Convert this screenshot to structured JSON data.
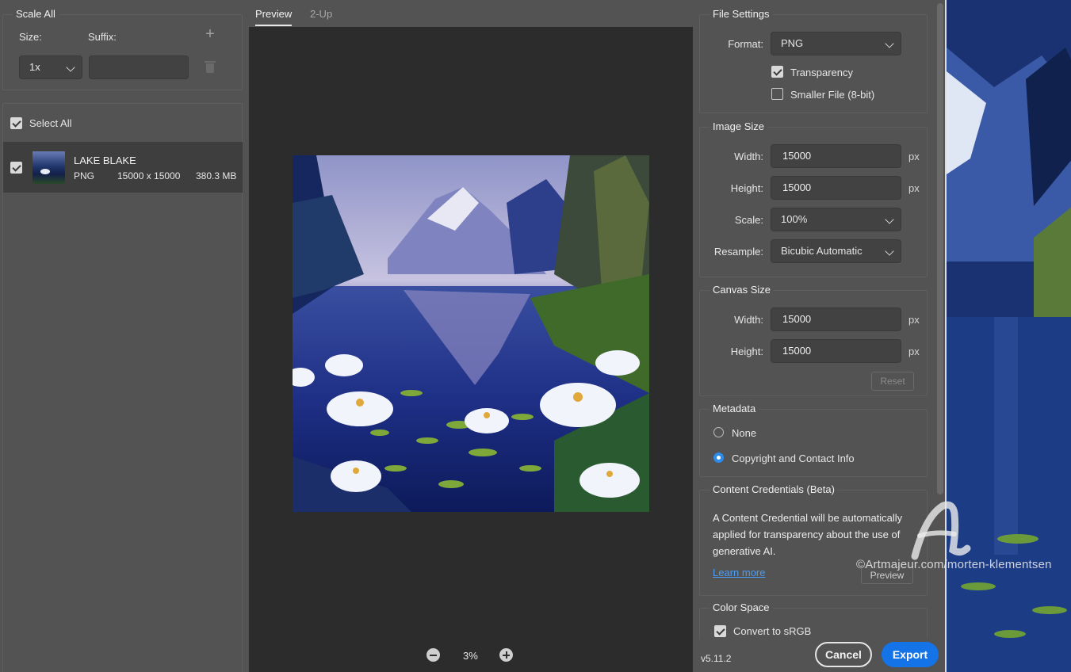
{
  "scale_all": {
    "title": "Scale All",
    "size_label": "Size:",
    "suffix_label": "Suffix:",
    "size_value": "1x",
    "suffix_value": ""
  },
  "asset_list": {
    "select_all_label": "Select All",
    "items": [
      {
        "name": "LAKE BLAKE",
        "format": "PNG",
        "dimensions": "15000 x 15000",
        "file_size": "380.3 MB"
      }
    ]
  },
  "preview": {
    "tabs": [
      "Preview",
      "2-Up"
    ],
    "zoom": "3%"
  },
  "file_settings": {
    "title": "File Settings",
    "format_label": "Format:",
    "format_value": "PNG",
    "transparency_label": "Transparency",
    "transparency_checked": true,
    "smaller_file_label": "Smaller File (8-bit)",
    "smaller_file_checked": false
  },
  "image_size": {
    "title": "Image Size",
    "width_label": "Width:",
    "width_value": "15000",
    "height_label": "Height:",
    "height_value": "15000",
    "scale_label": "Scale:",
    "scale_value": "100%",
    "resample_label": "Resample:",
    "resample_value": "Bicubic Automatic",
    "unit": "px"
  },
  "canvas_size": {
    "title": "Canvas Size",
    "width_label": "Width:",
    "width_value": "15000",
    "height_label": "Height:",
    "height_value": "15000",
    "unit": "px",
    "reset_label": "Reset"
  },
  "metadata": {
    "title": "Metadata",
    "options": [
      "None",
      "Copyright and Contact Info"
    ],
    "selected": "Copyright and Contact Info"
  },
  "content_credentials": {
    "title": "Content Credentials (Beta)",
    "text": "A Content Credential will be automatically applied for transparency about the use of generative AI.",
    "learn_more": "Learn more",
    "preview_label": "Preview"
  },
  "color_space": {
    "title": "Color Space",
    "convert_label": "Convert to sRGB",
    "convert_checked": true
  },
  "footer": {
    "version": "v5.11.2",
    "cancel_label": "Cancel",
    "export_label": "Export"
  },
  "watermark": {
    "text": "©Artmajeur.com/morten-klementsen"
  },
  "colors": {
    "panel_bg": "#535353",
    "canvas_bg": "#2c2c2c",
    "accent": "#1473e6",
    "link": "#4b9cf5"
  }
}
